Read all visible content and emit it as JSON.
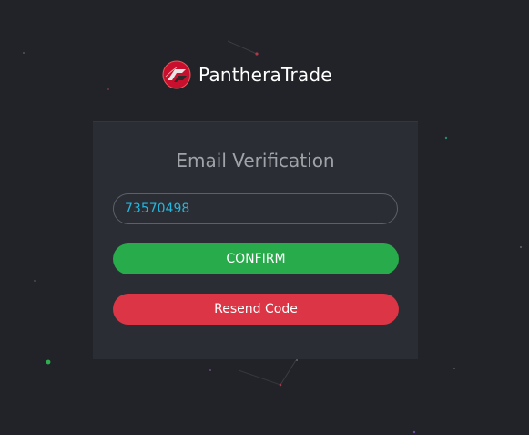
{
  "brand": {
    "name": "PantheraTrade"
  },
  "verification": {
    "title": "Email Verification",
    "code_value": "73570498",
    "confirm_label": "CONFIRM",
    "resend_label": "Resend Code"
  },
  "colors": {
    "background": "#212328",
    "card": "#2a2d33",
    "confirm": "#28ab4a",
    "resend": "#dc3545",
    "input_text": "#25b6dd",
    "logo_red": "#c8102e"
  }
}
